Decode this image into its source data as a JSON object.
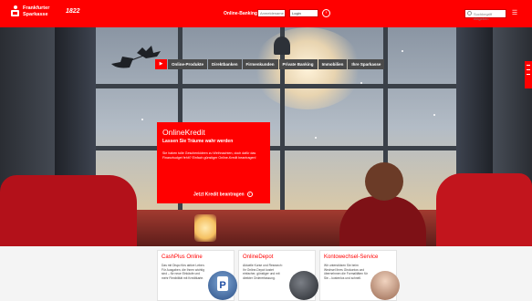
{
  "header": {
    "logo_line1": "Frankfurter",
    "logo_line2": "Sparkasse",
    "logo_sub": "1822",
    "login_label": "Online-Banking",
    "login_input_placeholder": "Anmeldename",
    "login_select_value": "Login",
    "login_submit_icon": "arrow-right-icon",
    "search_placeholder": "Suchbegriff eingeben",
    "search_icon": "search-icon",
    "menu_icon": "menu-icon",
    "accent_color": "#ff0000"
  },
  "nav": {
    "home_icon": "play-icon",
    "tabs": [
      {
        "label": "Online-Produkte"
      },
      {
        "label": "Direktbanken"
      },
      {
        "label": "Firmenkunden"
      },
      {
        "label": "Private Banking"
      },
      {
        "label": "Immobilien"
      },
      {
        "label": "Ihre Sparkasse"
      }
    ]
  },
  "promo": {
    "title": "OnlineKredit",
    "subtitle": "Lassen Sie Träume wahr werden",
    "body": "Sie haben tolle Geschenkideen zu Weihnachten, doch dafür das Finanzbudget fehlt? Einfach günstiger Online-Kredit beantragen!",
    "cta": "Jetzt Kredit beantragen",
    "cta_icon": "arrow-right-icon"
  },
  "teasers": [
    {
      "title": "CashPlus Online",
      "text": "Das mit Dispo fürs aktive Leben. Für Ausgaben, die Ihnen wichtig sind – für neue Einkäufe und mehr Flexibilität mit Kreditkarte."
    },
    {
      "title": "OnlineDepot",
      "text": "Aktuelle Kurse und Research: Ihr Online-Depot kostet einfacher, günstiger und mit direkter Ordererfassung."
    },
    {
      "title": "Kontowechsel-Service",
      "text": "Wir unterstützen Sie beim Wechsel Ihres Girokontos und übernehmen die Formalitäten für Sie – kostenlos und schnell."
    }
  ]
}
